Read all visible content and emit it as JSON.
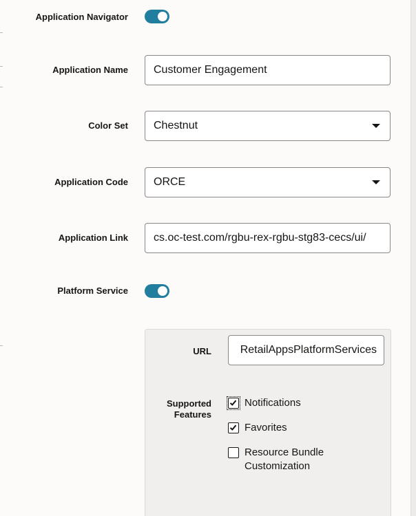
{
  "form": {
    "app_navigator": {
      "label": "Application Navigator",
      "enabled": true
    },
    "app_name": {
      "label": "Application Name",
      "value": "Customer Engagement"
    },
    "color_set": {
      "label": "Color Set",
      "value": "Chestnut"
    },
    "app_code": {
      "label": "Application Code",
      "value": "ORCE"
    },
    "app_link": {
      "label": "Application Link",
      "value": "cs.oc-test.com/rgbu-rex-rgbu-stg83-cecs/ui/"
    },
    "platform_service": {
      "label": "Platform Service",
      "enabled": true
    }
  },
  "platform": {
    "url": {
      "label": "URL",
      "value": "RetailAppsPlatformServices"
    },
    "features": {
      "label_line1": "Supported",
      "label_line2": "Features",
      "items": [
        {
          "label": "Notifications",
          "checked": true
        },
        {
          "label": "Favorites",
          "checked": true
        },
        {
          "label_line1": "Resource Bundle",
          "label_line2": "Customization",
          "checked": false
        }
      ]
    }
  },
  "colors": {
    "toggle_on": "#227e9e",
    "panel_bg": "#fcfbfa",
    "subpanel_bg": "#f1efed"
  }
}
